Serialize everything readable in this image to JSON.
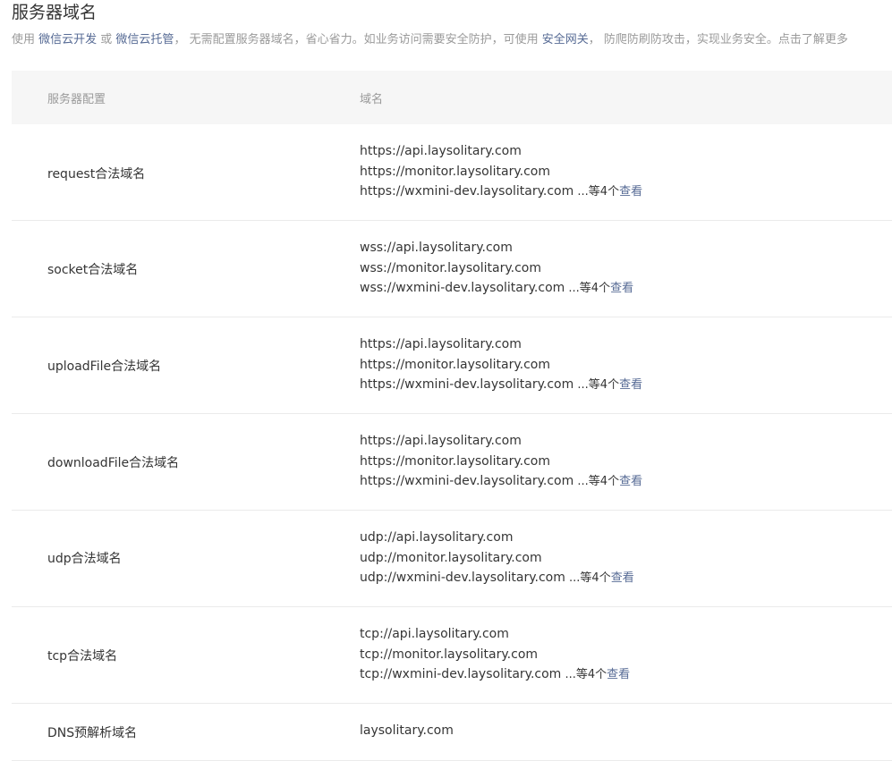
{
  "page": {
    "title": "服务器域名",
    "desc": {
      "prefix": "使用 ",
      "link1": "微信云开发",
      "or": " 或 ",
      "link2": "微信云托管",
      "middle": "， 无需配置服务器域名，省心省力。如业务访问需要安全防护，可使用 ",
      "link3": "安全网关",
      "suffix": "， 防爬防刷防攻击，实现业务安全。点击了解更多"
    }
  },
  "table": {
    "headers": {
      "config": "服务器配置",
      "domain": "域名"
    },
    "rows": [
      {
        "label": "request合法域名",
        "domains": [
          "https://api.laysolitary.com",
          "https://monitor.laysolitary.com",
          "https://wxmini-dev.laysolitary.com"
        ],
        "more": " ...等4个",
        "view": "查看"
      },
      {
        "label": "socket合法域名",
        "domains": [
          "wss://api.laysolitary.com",
          "wss://monitor.laysolitary.com",
          "wss://wxmini-dev.laysolitary.com"
        ],
        "more": " ...等4个",
        "view": "查看"
      },
      {
        "label": "uploadFile合法域名",
        "domains": [
          "https://api.laysolitary.com",
          "https://monitor.laysolitary.com",
          "https://wxmini-dev.laysolitary.com"
        ],
        "more": " ...等4个",
        "view": "查看"
      },
      {
        "label": "downloadFile合法域名",
        "domains": [
          "https://api.laysolitary.com",
          "https://monitor.laysolitary.com",
          "https://wxmini-dev.laysolitary.com"
        ],
        "more": " ...等4个",
        "view": "查看"
      },
      {
        "label": "udp合法域名",
        "domains": [
          "udp://api.laysolitary.com",
          "udp://monitor.laysolitary.com",
          "udp://wxmini-dev.laysolitary.com"
        ],
        "more": " ...等4个",
        "view": "查看"
      },
      {
        "label": "tcp合法域名",
        "domains": [
          "tcp://api.laysolitary.com",
          "tcp://monitor.laysolitary.com",
          "tcp://wxmini-dev.laysolitary.com"
        ],
        "more": " ...等4个",
        "view": "查看"
      },
      {
        "label": "DNS预解析域名",
        "domains": [
          "laysolitary.com"
        ]
      }
    ]
  }
}
